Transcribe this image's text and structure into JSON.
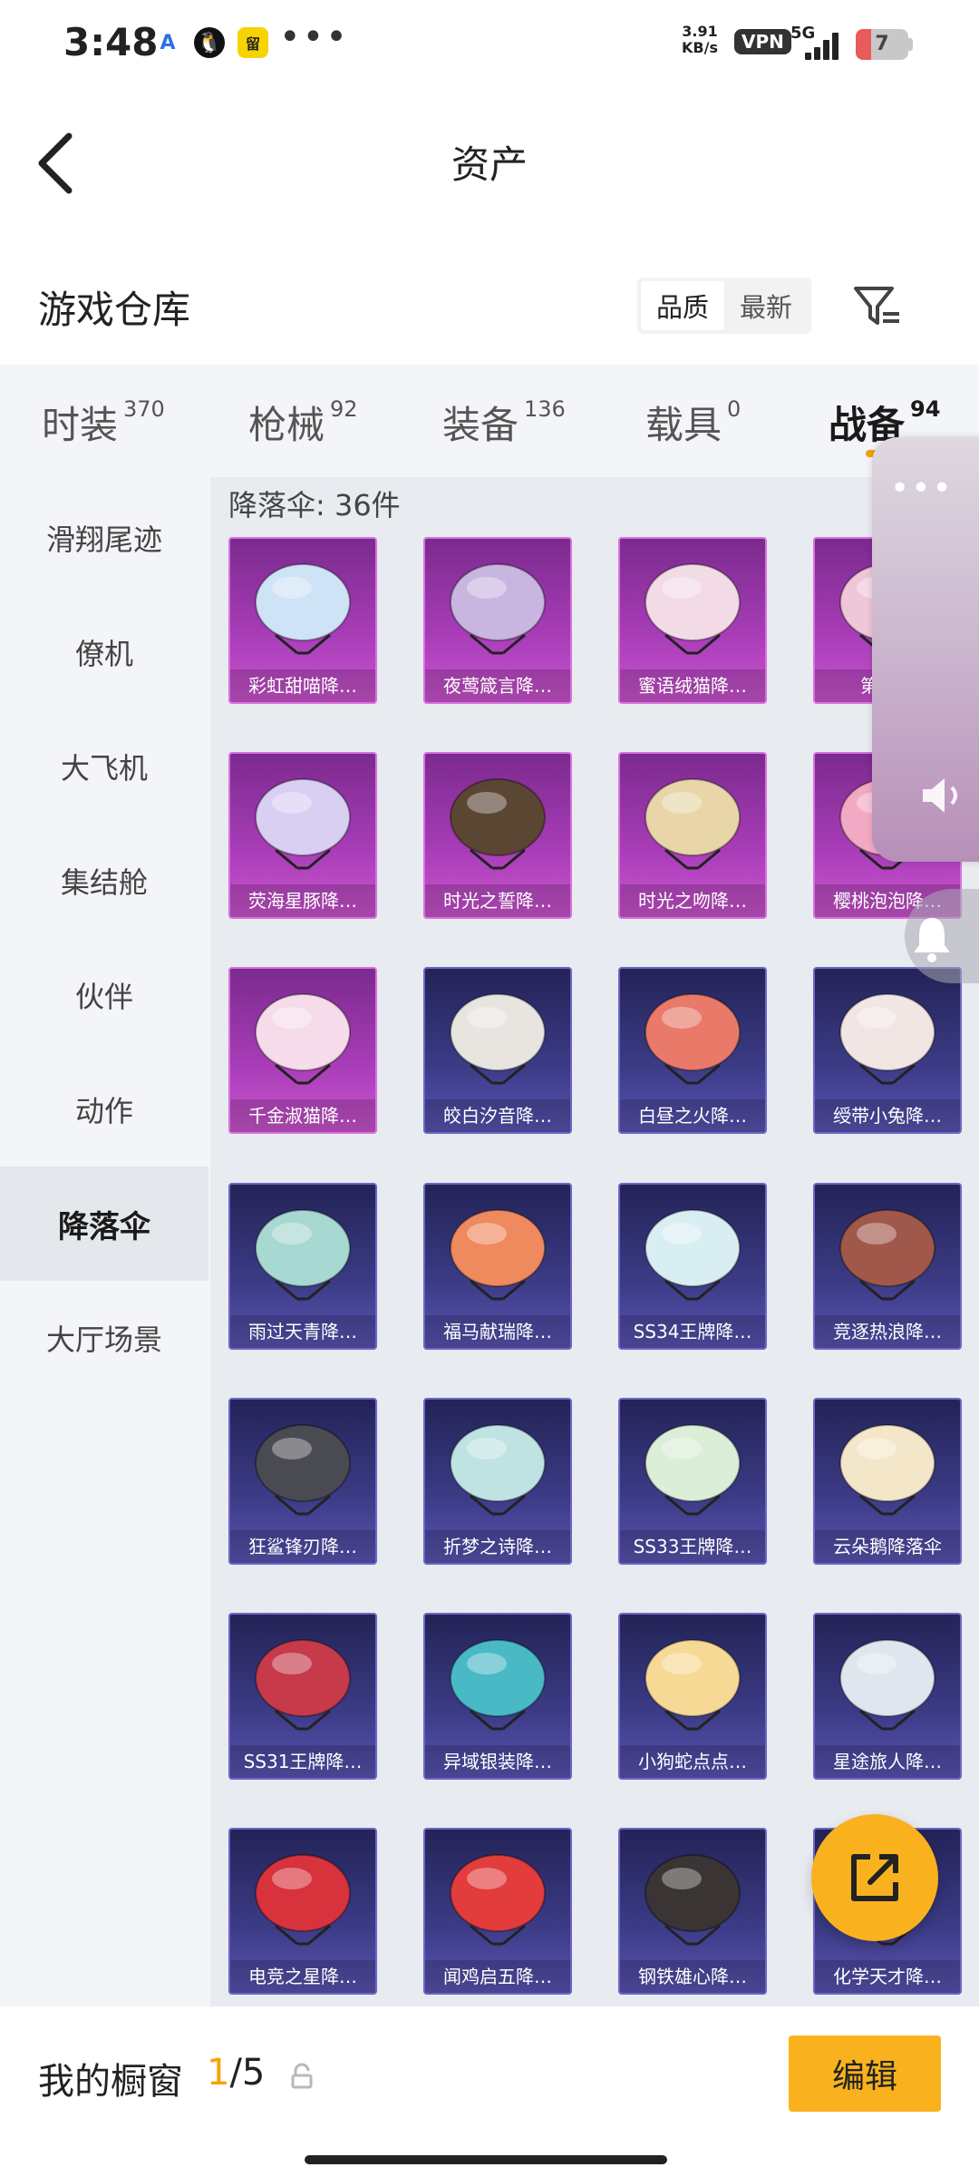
{
  "status_bar": {
    "time": "3:48",
    "app_icons": [
      "A",
      "🐧",
      "留"
    ],
    "more": "•••",
    "speed_value": "3.91",
    "speed_unit": "KB/s",
    "vpn": "VPN",
    "network": "5G",
    "battery": "7"
  },
  "header": {
    "title": "资产"
  },
  "warehouse": {
    "title": "游戏仓库",
    "sort_options": [
      "品质",
      "最新"
    ]
  },
  "tabs": [
    {
      "label": "时装",
      "count": "370"
    },
    {
      "label": "枪械",
      "count": "92"
    },
    {
      "label": "装备",
      "count": "136"
    },
    {
      "label": "载具",
      "count": "0"
    },
    {
      "label": "战备",
      "count": "94"
    }
  ],
  "sidebar": [
    {
      "label": "滑翔尾迹"
    },
    {
      "label": "僚机"
    },
    {
      "label": "大飞机"
    },
    {
      "label": "集结舱"
    },
    {
      "label": "伙伴"
    },
    {
      "label": "动作"
    },
    {
      "label": "降落伞"
    },
    {
      "label": "大厅场景"
    }
  ],
  "grid": {
    "label": "降落伞: 36件",
    "items": [
      {
        "name": "彩虹甜喵降…",
        "rarity": "pink",
        "color": "#cfe3f6"
      },
      {
        "name": "夜莺箴言降…",
        "rarity": "pink",
        "color": "#c9b6e0"
      },
      {
        "name": "蜜语绒猫降…",
        "rarity": "pink",
        "color": "#f3dbe6"
      },
      {
        "name": "第五…",
        "rarity": "pink",
        "color": "#f0c7d8"
      },
      {
        "name": "荧海星豚降…",
        "rarity": "pink",
        "color": "#d8cff3"
      },
      {
        "name": "时光之誓降…",
        "rarity": "pink",
        "color": "#5b4634"
      },
      {
        "name": "时光之吻降…",
        "rarity": "pink",
        "color": "#e8d6a9"
      },
      {
        "name": "樱桃泡泡降…",
        "rarity": "pink",
        "color": "#f2a9c3"
      },
      {
        "name": "千金淑猫降…",
        "rarity": "pink",
        "color": "#f6dcea"
      },
      {
        "name": "皎白汐音降…",
        "rarity": "blue",
        "color": "#e8e4e0"
      },
      {
        "name": "白昼之火降…",
        "rarity": "blue",
        "color": "#e97a6a"
      },
      {
        "name": "绶带小兔降…",
        "rarity": "blue",
        "color": "#f1e6e3"
      },
      {
        "name": "雨过天青降…",
        "rarity": "blue",
        "color": "#a8d8d2"
      },
      {
        "name": "福马献瑞降…",
        "rarity": "blue",
        "color": "#ef8a5e"
      },
      {
        "name": "SS34王牌降…",
        "rarity": "blue",
        "color": "#d9eef3"
      },
      {
        "name": "竞逐热浪降…",
        "rarity": "blue",
        "color": "#a0584a"
      },
      {
        "name": "狂鲨锋刃降…",
        "rarity": "blue",
        "color": "#4a4a52"
      },
      {
        "name": "折梦之诗降…",
        "rarity": "blue",
        "color": "#bfe3e2"
      },
      {
        "name": "SS33王牌降…",
        "rarity": "blue",
        "color": "#dbeed8"
      },
      {
        "name": "云朵鹅降落伞",
        "rarity": "blue",
        "color": "#f4e7c9"
      },
      {
        "name": "SS31王牌降…",
        "rarity": "blue",
        "color": "#c63a4a"
      },
      {
        "name": "异域银装降…",
        "rarity": "blue",
        "color": "#49b9c6"
      },
      {
        "name": "小狗蛇点点…",
        "rarity": "blue",
        "color": "#f6d995"
      },
      {
        "name": "星途旅人降…",
        "rarity": "blue",
        "color": "#dfe6ee"
      },
      {
        "name": "电竞之星降…",
        "rarity": "blue",
        "color": "#d8323c"
      },
      {
        "name": "闻鸡启五降…",
        "rarity": "blue",
        "color": "#e23c3c"
      },
      {
        "name": "钢铁雄心降…",
        "rarity": "blue",
        "color": "#3a3434"
      },
      {
        "name": "化学天才降…",
        "rarity": "blue",
        "color": "#8fa8d0"
      }
    ]
  },
  "overlay": {
    "dots": "•••"
  },
  "bottom_bar": {
    "label": "我的橱窗",
    "current": "1",
    "total": "/5",
    "edit": "编辑"
  },
  "colors": {
    "accent": "#f9b21d",
    "tab_underline": "#f5a300",
    "pink_card": "#a93db8",
    "blue_card": "#3c3b86"
  }
}
